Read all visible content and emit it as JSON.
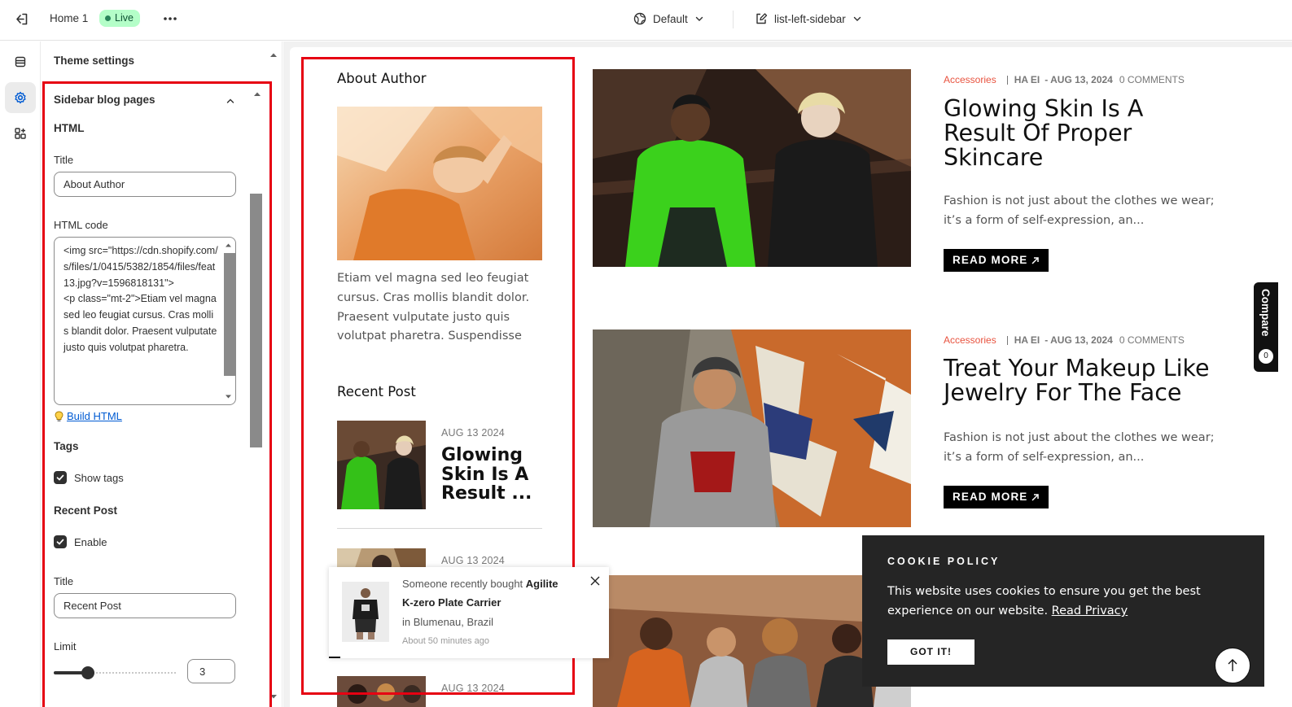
{
  "topbar": {
    "home_label": "Home 1",
    "status_badge": "Live",
    "theme_label": "Default",
    "template_label": "list-left-sidebar"
  },
  "panel": {
    "header": "Theme settings",
    "section_title": "Sidebar blog pages",
    "html_heading": "HTML",
    "title_label": "Title",
    "title_value": "About Author",
    "html_code_label": "HTML code",
    "html_code_value": "<img src=\"https://cdn.shopify.com/s/files/1/0415/5382/1854/files/feat13.jpg?v=1596818131\">\n<p class=\"mt-2\">Etiam vel magna sed leo feugiat cursus. Cras mollis blandit dolor. Praesent vulputate justo quis volutpat pharetra.",
    "build_link": "Build HTML",
    "tags_heading": "Tags",
    "show_tags_label": "Show tags",
    "recent_post_heading": "Recent Post",
    "enable_label": "Enable",
    "recent_title_label": "Title",
    "recent_title_value": "Recent Post",
    "limit_label": "Limit",
    "limit_value": "3",
    "limit_fraction": 0.2
  },
  "preview": {
    "sidebar": {
      "about_heading": "About Author",
      "about_text": "Etiam vel magna sed leo feugiat cursus. Cras mollis blandit dolor. Praesent vulputate justo quis volutpat pharetra. Suspendisse",
      "recent_heading": "Recent Post",
      "recent_posts": [
        {
          "date": "AUG 13 2024",
          "title": "Glowing Skin Is A Result ..."
        },
        {
          "date": "AUG 13 2024"
        },
        {
          "date": "AUG 13 2024"
        }
      ]
    },
    "posts": [
      {
        "category": "Accessories",
        "author": "HA EI",
        "date": "- AUG 13, 2024",
        "comments": "0 COMMENTS",
        "title": "Glowing Skin Is A Result Of Proper Skincare",
        "excerpt": "Fashion is not just about the clothes we wear; it’s a form of self-expression, an...",
        "button": "READ MORE"
      },
      {
        "category": "Accessories",
        "author": "HA EI",
        "date": "- AUG 13, 2024",
        "comments": "0 COMMENTS",
        "title": "Treat Your Makeup Like Jewelry For The Face",
        "excerpt": "Fashion is not just about the clothes we wear; it’s a form of self-expression, an...",
        "button": "READ MORE"
      }
    ],
    "compare_label": "Compare",
    "compare_count": "0",
    "toast": {
      "prefix": "Someone recently bought",
      "product_line1": "Agilite",
      "product_line2": "K-zero Plate Carrier",
      "location": "in Blumenau, Brazil",
      "time": "About 50 minutes ago"
    },
    "cookie": {
      "heading": "COOKIE POLICY",
      "text": "This website uses cookies to ensure you get the best experience on our website.",
      "link": "Read Privacy",
      "button": "GOT IT!"
    }
  },
  "colors": {
    "accent_red": "#e60012",
    "live_badge_bg": "#b4fec8",
    "category": "#e8533f"
  }
}
